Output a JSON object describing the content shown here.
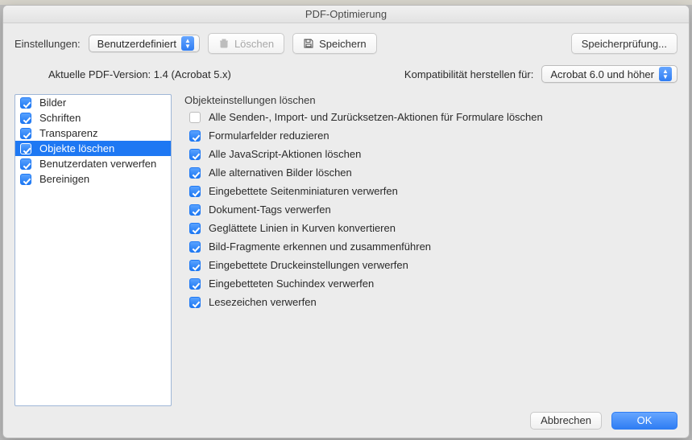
{
  "window": {
    "title": "PDF-Optimierung"
  },
  "toolbar": {
    "settings_label": "Einstellungen:",
    "settings_value": "Benutzerdefiniert",
    "delete_label": "Löschen",
    "save_label": "Speichern",
    "audit_label": "Speicherprüfung..."
  },
  "version": {
    "current_label": "Aktuelle PDF-Version: 1.4 (Acrobat 5.x)",
    "compat_label": "Kompatibilität herstellen für:",
    "compat_value": "Acrobat 6.0 und höher"
  },
  "sidebar": {
    "items": [
      {
        "label": "Bilder",
        "checked": true
      },
      {
        "label": "Schriften",
        "checked": true
      },
      {
        "label": "Transparenz",
        "checked": true
      },
      {
        "label": "Objekte löschen",
        "checked": true
      },
      {
        "label": "Benutzerdaten verwerfen",
        "checked": true
      },
      {
        "label": "Bereinigen",
        "checked": true
      }
    ],
    "selected_index": 3
  },
  "panel": {
    "heading": "Objekteinstellungen löschen",
    "options": [
      {
        "label": "Alle Senden-, Import- und Zurücksetzen-Aktionen für Formulare löschen",
        "checked": false
      },
      {
        "label": "Formularfelder reduzieren",
        "checked": true
      },
      {
        "label": "Alle JavaScript-Aktionen löschen",
        "checked": true
      },
      {
        "label": "Alle alternativen Bilder löschen",
        "checked": true
      },
      {
        "label": "Eingebettete Seitenminiaturen verwerfen",
        "checked": true
      },
      {
        "label": "Dokument-Tags verwerfen",
        "checked": true
      },
      {
        "label": "Geglättete Linien in Kurven konvertieren",
        "checked": true
      },
      {
        "label": "Bild-Fragmente erkennen und zusammenführen",
        "checked": true
      },
      {
        "label": "Eingebettete Druckeinstellungen verwerfen",
        "checked": true
      },
      {
        "label": "Eingebetteten Suchindex verwerfen",
        "checked": true
      },
      {
        "label": "Lesezeichen verwerfen",
        "checked": true
      }
    ]
  },
  "footer": {
    "cancel_label": "Abbrechen",
    "ok_label": "OK"
  },
  "colors": {
    "accent": "#1e78f3",
    "accent_light": "#5aa2ff",
    "sheet_bg": "#ececec"
  },
  "icons": {
    "trash_icon": "trash-icon",
    "floppy_icon": "floppy-icon",
    "chevron_updown_icon": "chevron-updown-icon"
  }
}
